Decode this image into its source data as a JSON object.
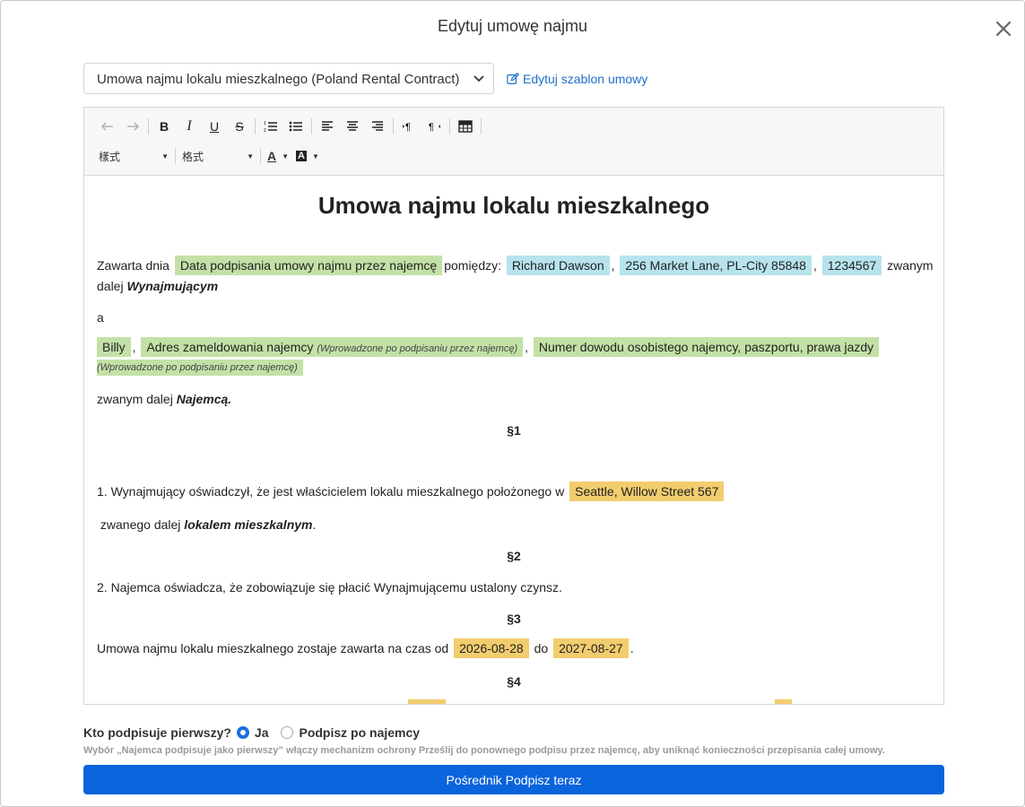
{
  "modal": {
    "title": "Edytuj umowę najmu"
  },
  "template_select": {
    "value": "Umowa najmu lokalu mieszkalnego (Poland Rental Contract)"
  },
  "edit_template_link": {
    "label": "Edytuj szablon umowy"
  },
  "toolbar": {
    "bold": "B",
    "italic": "I",
    "underline": "U",
    "strike": "S",
    "style_dropdown": "樣式",
    "format_dropdown": "格式",
    "font_color": "A",
    "bg_color": "A"
  },
  "document": {
    "title": "Umowa najmu lokalu mieszkalnego",
    "p1_prefix": "Zawarta dnia",
    "p1_sign_date": "Data podpisania umowy najmu przez najemcę",
    "p1_between": "pomiędzy:",
    "landlord_name": "Richard Dawson",
    "comma1": ",",
    "landlord_address": "256 Market Lane, PL-City 85848",
    "comma2": ",",
    "landlord_id": "1234567",
    "p1_suffix": "zwanym",
    "p1_line2_prefix": "dalej",
    "p1_landlord_role": "Wynajmującym",
    "and": "a",
    "tenant_name": "Billy",
    "comma3": ",",
    "tenant_address": "Adres zameldowania najemcy",
    "tenant_address_note": "(Wprowadzone po podpisaniu przez najemcę)",
    "comma4": ",",
    "tenant_id": "Numer dowodu osobistego najemcy, paszportu, prawa jazdy",
    "tenant_id_note": "(Wprowadzone po podpisaniu przez najemcę)",
    "tenant_role_prefix": "zwanym dalej",
    "tenant_role": "Najemcą.",
    "s1": "§1",
    "s1_text": "1. Wynajmujący oświadczył, że jest właścicielem lokalu mieszkalnego położonego w",
    "property_address": "Seattle, Willow Street 567",
    "s1_cont_prefix": "zwanego dalej",
    "s1_cont_term": "lokalem mieszkalnym",
    "s1_cont_suffix": ".",
    "s2": "§2",
    "s2_text": "2. Najemca oświadcza, że zobowiązuje się płacić Wynajmującemu ustalony czynsz.",
    "s3": "§3",
    "s3_prefix": "Umowa najmu lokalu mieszkalnego zostaje zawarta na czas od",
    "start_date": "2026-08-28",
    "s3_to": "do",
    "end_date": "2027-08-27",
    "s3_suffix": ".",
    "s4": "§4"
  },
  "signer": {
    "question": "Kto podpisuje pierwszy?",
    "option_me": "Ja",
    "option_after": "Podpisz po najemcy",
    "selected": "Ja"
  },
  "hint": "Wybór „Najemca podpisuje jako pierwszy” włączy mechanizm ochrony Prześlij do ponownego podpisu przez najemcę, aby uniknąć konieczności przepisania całej umowy.",
  "submit_button": {
    "label": "Pośrednik Podpisz teraz"
  },
  "colors": {
    "accent": "#0a64dc",
    "link": "#1f6fc9",
    "tag_green": "#c3e1a7",
    "tag_blue": "#b7e3ec",
    "tag_orange": "#f2cd6e"
  }
}
